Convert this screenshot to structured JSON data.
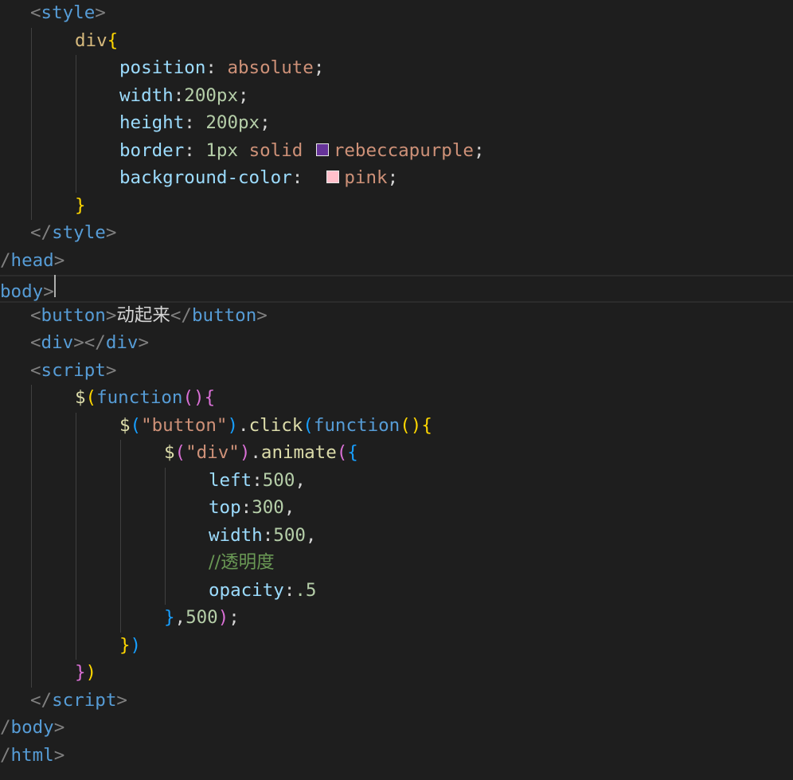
{
  "editor": {
    "theme_background": "#1e1e1e",
    "current_line_number": 11,
    "swatch_colors": {
      "rebeccapurple": "#663399",
      "pink": "#ffc0cb"
    },
    "lines": [
      [
        [
          "punct",
          "<"
        ],
        [
          "tag",
          "style"
        ],
        [
          "punct",
          ">"
        ]
      ],
      [
        [
          "sel",
          "div"
        ],
        [
          "brace-y",
          "{"
        ]
      ],
      [
        [
          "prop",
          "position"
        ],
        [
          "text",
          ": "
        ],
        [
          "val",
          "absolute"
        ],
        [
          "text",
          ";"
        ]
      ],
      [
        [
          "prop",
          "width"
        ],
        [
          "text",
          ":"
        ],
        [
          "num",
          "200px"
        ],
        [
          "text",
          ";"
        ]
      ],
      [
        [
          "prop",
          "height"
        ],
        [
          "text",
          ": "
        ],
        [
          "num",
          "200px"
        ],
        [
          "text",
          ";"
        ]
      ],
      [
        [
          "prop",
          "border"
        ],
        [
          "text",
          ": "
        ],
        [
          "num",
          "1px"
        ],
        [
          "text",
          " "
        ],
        [
          "val",
          "solid"
        ],
        [
          "text",
          " "
        ],
        [
          "swatch",
          "#663399"
        ],
        [
          "val",
          "rebeccapurple"
        ],
        [
          "text",
          ";"
        ]
      ],
      [
        [
          "prop",
          "background-color"
        ],
        [
          "text",
          ":  "
        ],
        [
          "swatch",
          "#ffc0cb"
        ],
        [
          "val",
          "pink"
        ],
        [
          "text",
          ";"
        ]
      ],
      [
        [
          "brace-y",
          "}"
        ]
      ],
      [
        [
          "punct",
          "</"
        ],
        [
          "tag",
          "style"
        ],
        [
          "punct",
          ">"
        ]
      ],
      [
        [
          "punct",
          "/"
        ],
        [
          "tag",
          "head"
        ],
        [
          "punct",
          ">"
        ]
      ],
      [
        [
          "tag",
          "body"
        ],
        [
          "punct",
          ">"
        ],
        [
          "cursor",
          ""
        ]
      ],
      [
        [
          "punct",
          "<"
        ],
        [
          "tag",
          "button"
        ],
        [
          "punct",
          ">"
        ],
        [
          "cjk",
          "动起来"
        ],
        [
          "punct",
          "</"
        ],
        [
          "tag",
          "button"
        ],
        [
          "punct",
          ">"
        ]
      ],
      [
        [
          "punct",
          "<"
        ],
        [
          "tag",
          "div"
        ],
        [
          "punct",
          "></"
        ],
        [
          "tag",
          "div"
        ],
        [
          "punct",
          ">"
        ]
      ],
      [
        [
          "punct",
          "<"
        ],
        [
          "tag",
          "script"
        ],
        [
          "punct",
          ">"
        ]
      ],
      [
        [
          "fn",
          "$"
        ],
        [
          "brace-y",
          "("
        ],
        [
          "kw",
          "function"
        ],
        [
          "brace-p",
          "()"
        ],
        [
          "brace-p",
          "{"
        ]
      ],
      [
        [
          "fn",
          "$"
        ],
        [
          "brace-b",
          "("
        ],
        [
          "str",
          "\"button\""
        ],
        [
          "brace-b",
          ")"
        ],
        [
          "text",
          "."
        ],
        [
          "fn",
          "click"
        ],
        [
          "brace-b",
          "("
        ],
        [
          "kw",
          "function"
        ],
        [
          "brace-y",
          "()"
        ],
        [
          "brace-y",
          "{"
        ]
      ],
      [
        [
          "fn",
          "$"
        ],
        [
          "brace-p",
          "("
        ],
        [
          "str",
          "\"div\""
        ],
        [
          "brace-p",
          ")"
        ],
        [
          "text",
          "."
        ],
        [
          "fn",
          "animate"
        ],
        [
          "brace-p",
          "("
        ],
        [
          "brace-b",
          "{"
        ]
      ],
      [
        [
          "prop",
          "left"
        ],
        [
          "text",
          ":"
        ],
        [
          "num",
          "500"
        ],
        [
          "text",
          ","
        ]
      ],
      [
        [
          "prop",
          "top"
        ],
        [
          "text",
          ":"
        ],
        [
          "num",
          "300"
        ],
        [
          "text",
          ","
        ]
      ],
      [
        [
          "prop",
          "width"
        ],
        [
          "text",
          ":"
        ],
        [
          "num",
          "500"
        ],
        [
          "text",
          ","
        ]
      ],
      [
        [
          "comment",
          "//透明度"
        ]
      ],
      [
        [
          "prop",
          "opacity"
        ],
        [
          "text",
          ":"
        ],
        [
          "num",
          ".5"
        ]
      ],
      [
        [
          "brace-b",
          "}"
        ],
        [
          "text",
          ","
        ],
        [
          "num",
          "500"
        ],
        [
          "brace-p",
          ")"
        ],
        [
          "text",
          ";"
        ]
      ],
      [
        [
          "brace-y",
          "}"
        ],
        [
          "brace-b",
          ")"
        ]
      ],
      [
        [
          "brace-p",
          "}"
        ],
        [
          "brace-y",
          ")"
        ]
      ],
      [
        [
          "punct",
          "</"
        ],
        [
          "tag",
          "script"
        ],
        [
          "punct",
          ">"
        ]
      ],
      [
        [
          "punct",
          "/"
        ],
        [
          "tag",
          "body"
        ],
        [
          "punct",
          ">"
        ]
      ],
      [
        [
          "punct",
          "/"
        ],
        [
          "tag",
          "html"
        ],
        [
          "punct",
          ">"
        ]
      ]
    ]
  }
}
